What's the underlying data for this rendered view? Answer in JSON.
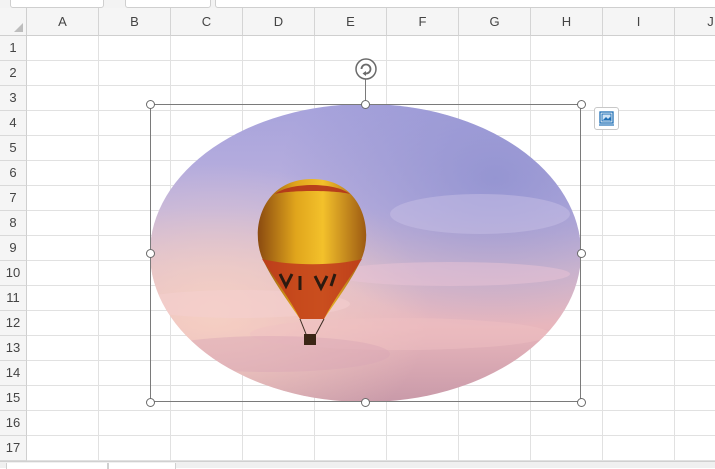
{
  "columns": [
    "A",
    "B",
    "C",
    "D",
    "E",
    "F",
    "G",
    "H",
    "I",
    "J"
  ],
  "rows": [
    "1",
    "2",
    "3",
    "4",
    "5",
    "6",
    "7",
    "8",
    "9",
    "10",
    "11",
    "12",
    "13",
    "14",
    "15",
    "16",
    "17"
  ],
  "picture": {
    "shape": "oval",
    "content": "hot-air-balloon-sky-photo",
    "selected": true
  },
  "icons": {
    "rotate": "rotate-handle-icon",
    "layout": "layout-options-icon",
    "corner": "select-all-triangle-icon"
  },
  "colors": {
    "header_bg": "#f5f5f5",
    "gridline": "#e1e1e1",
    "selection_border": "#7a7a7a",
    "handle_fill": "#ffffff",
    "layout_icon": "#1f6fb5"
  }
}
